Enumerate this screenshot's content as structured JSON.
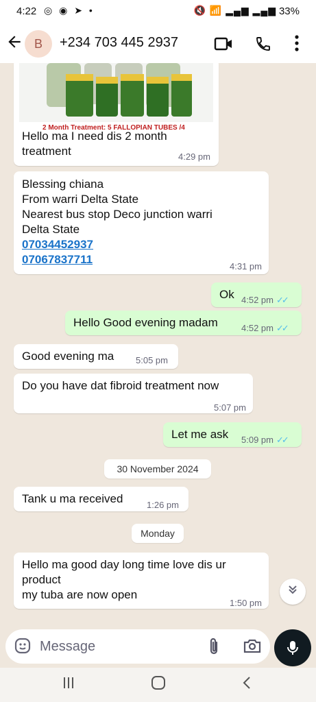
{
  "status_bar": {
    "time": "4:22",
    "battery": "33%",
    "left_icons": [
      "whatsapp-icon",
      "messenger-icon",
      "telegram-icon",
      "dot-icon"
    ],
    "right_icons": [
      "mute-icon",
      "wifi-icon",
      "signal-icon",
      "signal-icon"
    ]
  },
  "header": {
    "avatar_initial": "B",
    "contact": "+234 703 445 2937",
    "icons": [
      "back-arrow-icon",
      "video-call-icon",
      "phone-icon",
      "more-vertical-icon"
    ]
  },
  "image_caption_partial": "2 Month Treatment: 5 FALLOPIAN TUBES /4",
  "messages": [
    {
      "dir": "in",
      "lines": [
        "Hello ma I need dis 2 month",
        "treatment"
      ],
      "time": "4:29 pm"
    },
    {
      "dir": "in",
      "lines": [
        "Blessing chiana",
        "From warri Delta State",
        "Nearest bus stop Deco  junction warri",
        "Delta State"
      ],
      "links": [
        "07034452937",
        "07067837711"
      ],
      "time": "4:31 pm"
    },
    {
      "dir": "out",
      "text": "Ok",
      "time": "4:52 pm",
      "status": "read"
    },
    {
      "dir": "out",
      "text": "Hello Good evening madam",
      "time": "4:52 pm",
      "status": "read"
    },
    {
      "dir": "in",
      "text": "Good evening ma",
      "time": "5:05 pm"
    },
    {
      "dir": "in",
      "text": "Do you have dat fibroid treatment now",
      "time": "5:07 pm"
    },
    {
      "dir": "out",
      "text": "Let me ask",
      "time": "5:09 pm",
      "status": "read"
    },
    {
      "dir": "in",
      "text": "Tank u ma received",
      "time": "1:26 pm"
    },
    {
      "dir": "in",
      "lines": [
        "Hello ma good day long time love dis ur",
        "product",
        "my tuba are now open"
      ],
      "time": "1:50 pm"
    }
  ],
  "date_separators": [
    "30 November 2024",
    "Monday"
  ],
  "composer": {
    "placeholder": "Message"
  },
  "colors": {
    "incoming": "#ffffff",
    "outgoing": "#d9fdd3",
    "read_tick": "#53bdeb",
    "background": "#efe7dd",
    "mic": "#111b21"
  }
}
